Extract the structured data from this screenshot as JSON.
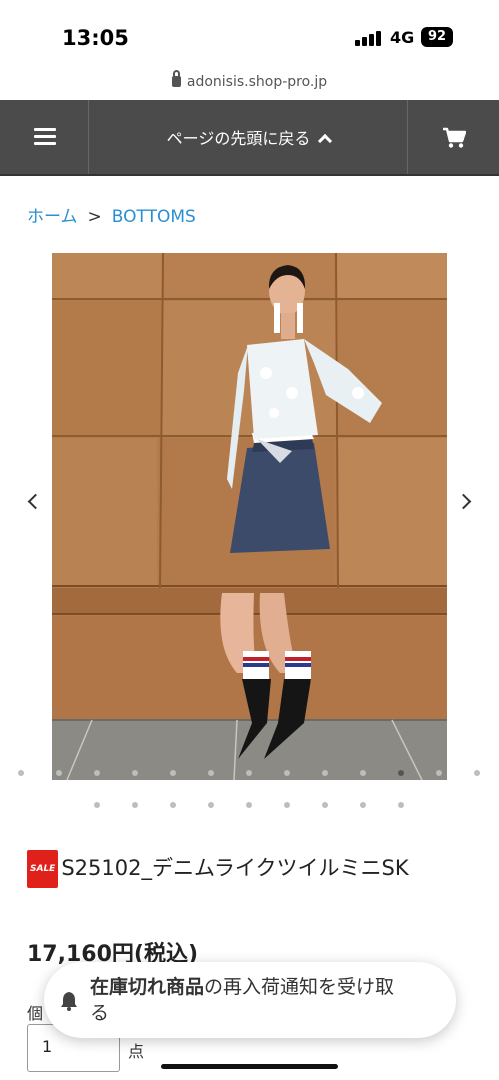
{
  "status_bar": {
    "time": "13:05",
    "network": "4G",
    "battery": "92"
  },
  "browser": {
    "url": "adonisis.shop-pro.jp",
    "lock_icon": "lock-icon"
  },
  "navbar": {
    "menu_icon": "hamburger-icon",
    "back_to_top_label": "ページの先頭に戻る",
    "back_icon": "chevron-up-icon",
    "cart_icon": "cart-icon",
    "bg_color": "#4b4b4b"
  },
  "breadcrumb": {
    "home": "ホーム",
    "separator": ">",
    "category": "BOTTOMS"
  },
  "gallery": {
    "prev_icon": "chevron-left-icon",
    "next_icon": "chevron-right-icon",
    "thumbnail_dots_row1": 13,
    "active_dot_row1": 11,
    "thumbnail_dots_row2": 9
  },
  "product": {
    "sale_badge": "SALE",
    "name": "S25102_デニムライクツイルミニSK",
    "price": "17,160円(税込)",
    "quantity_label": "個",
    "quantity_value": "1",
    "quantity_unit": "点"
  },
  "notify": {
    "bold_text": "在庫切れ商品",
    "rest_text": "の再入荷通知を受け取る",
    "icon": "bell-icon"
  }
}
